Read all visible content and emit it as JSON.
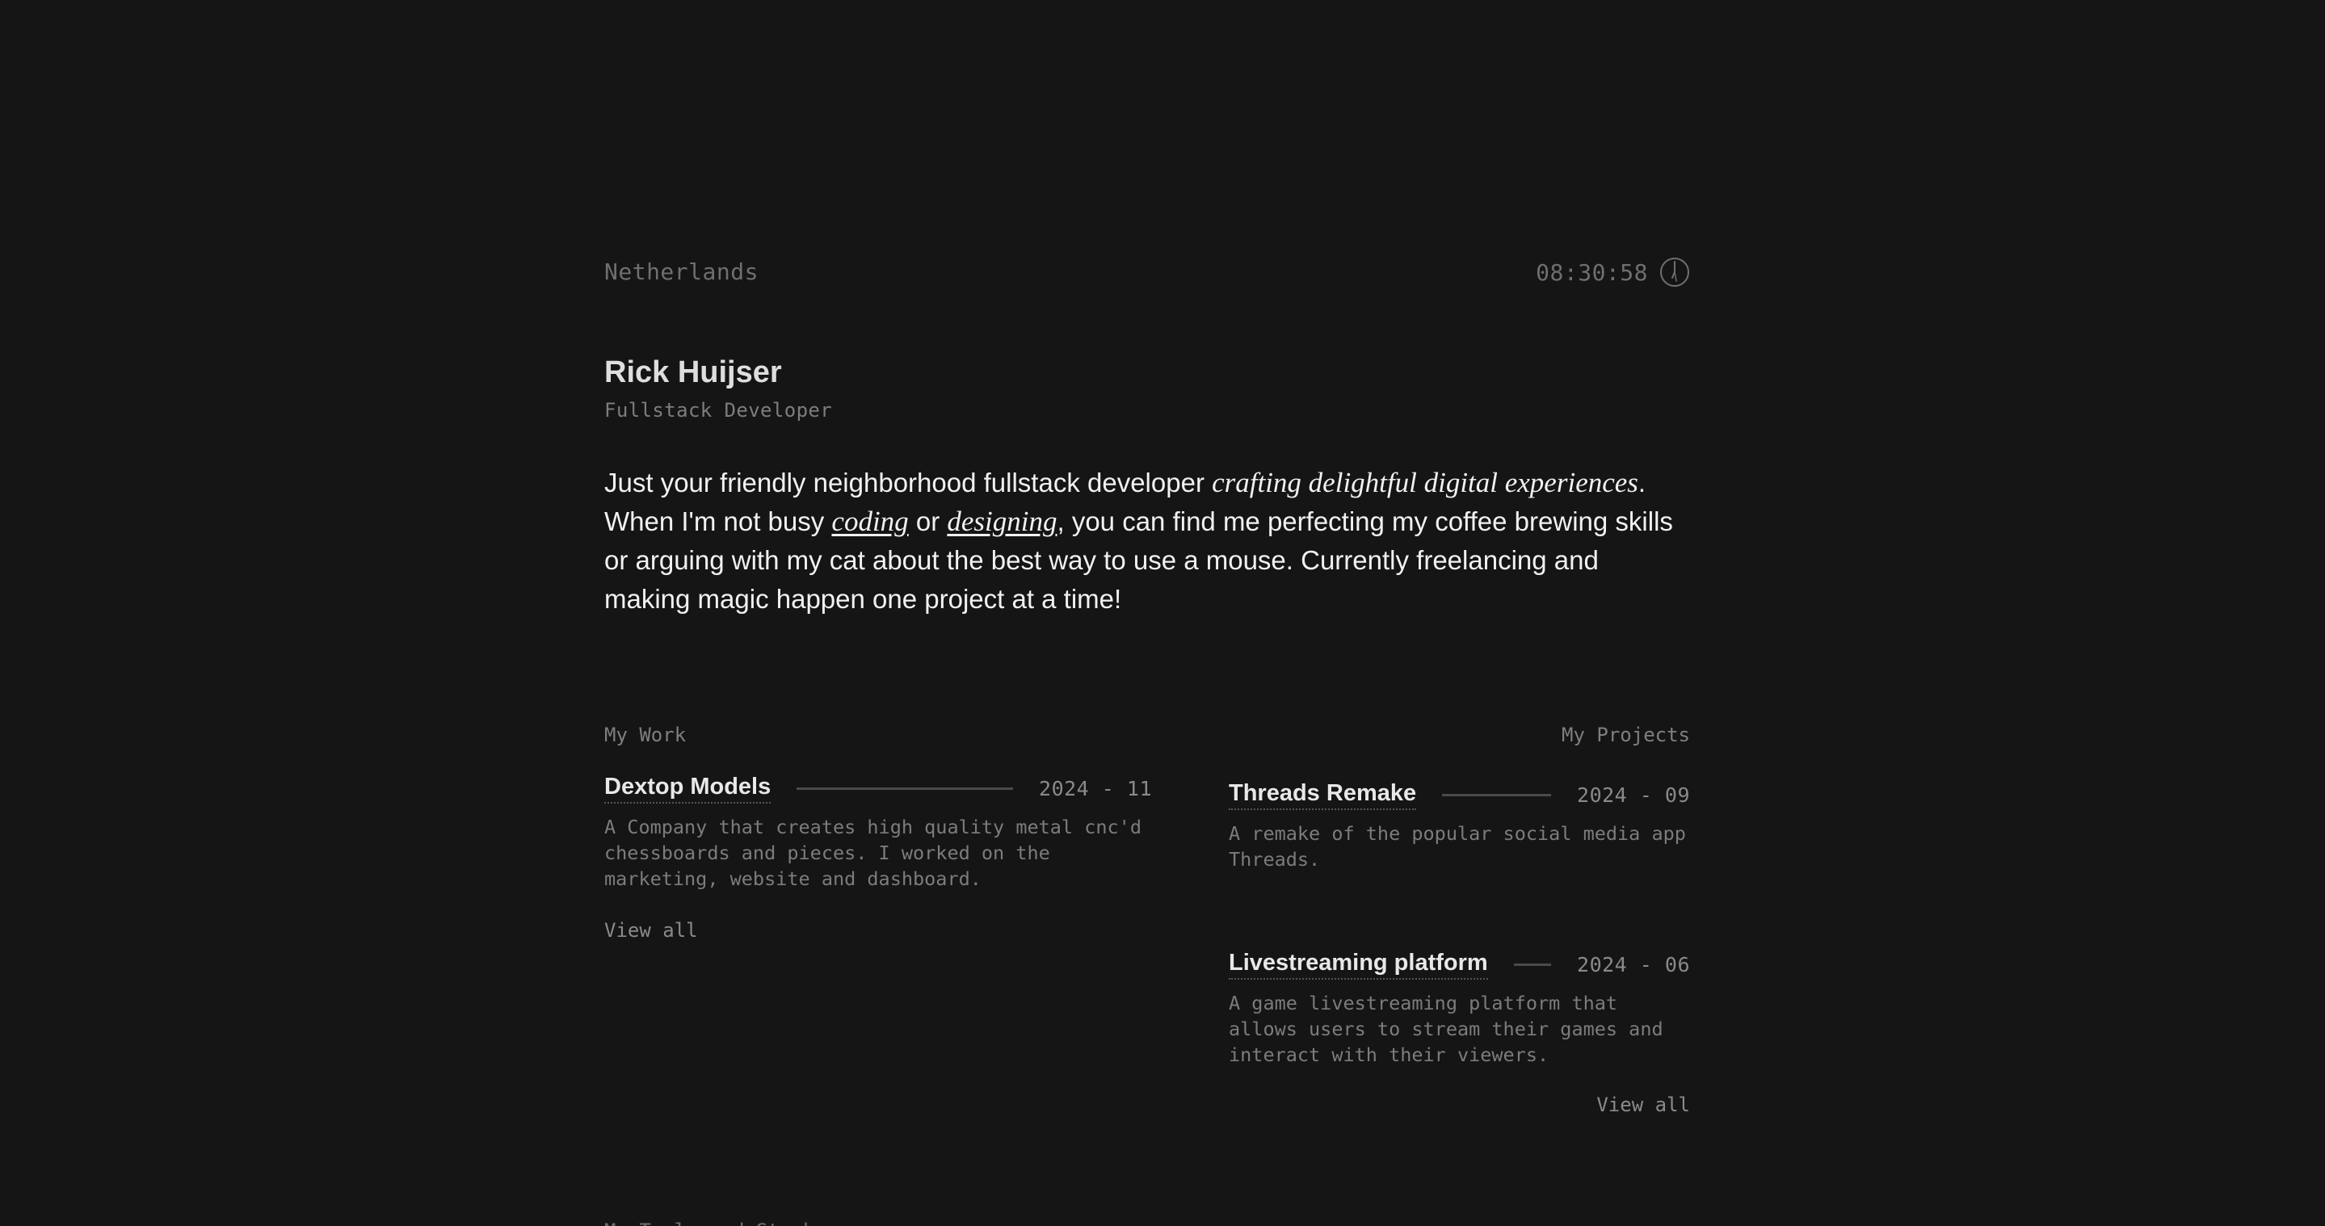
{
  "topbar": {
    "location": "Netherlands",
    "time": "08:30:58",
    "clock_icon": "clock-icon"
  },
  "header": {
    "name": "Rick Huijser",
    "role": "Fullstack Developer"
  },
  "bio": {
    "part1": "Just your friendly neighborhood fullstack developer ",
    "highlight": "crafting delightful digital experiences",
    "part2": ". When I'm not busy ",
    "link1": "coding",
    "part3": " or ",
    "link2": "designing",
    "part4": ", you can find me perfecting my coffee brewing skills or arguing with my cat about the best way to use a mouse. Currently freelancing and making magic happen one project at a time!"
  },
  "work": {
    "title": "My Work",
    "items": [
      {
        "title": "Dextop Models",
        "date": "2024 - 11",
        "description": "A Company that creates high quality metal cnc'd chessboards and pieces. I worked on the marketing, website and dashboard."
      }
    ],
    "view_all": "View all"
  },
  "projects": {
    "title": "My Projects",
    "items": [
      {
        "title": "Threads Remake",
        "date": "2024 - 09",
        "description": "A remake of the popular social media app Threads."
      },
      {
        "title": "Livestreaming platform",
        "date": "2024 - 06",
        "description": "A game livestreaming platform that allows users to stream their games and interact with their viewers."
      }
    ],
    "view_all": "View all"
  },
  "bottom_peek": "My Tools and Stack"
}
